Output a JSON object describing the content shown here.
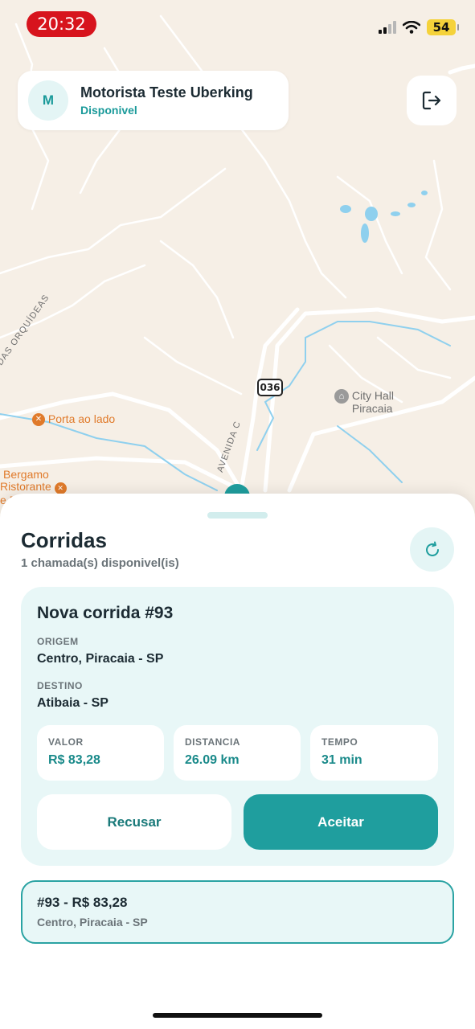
{
  "status_bar": {
    "time": "20:32",
    "battery": "54"
  },
  "map": {
    "labels": {
      "orquideas": "DAS ORQUÍDEAS",
      "porta": "Porta ao lado",
      "city_hall_line1": "City Hall",
      "city_hall_line2": "Piracaia",
      "avenida": "AVENIDA C",
      "bergamo_line1": "Bergamo",
      "bergamo_line2": "Ristorante",
      "bergamo_line3": "e F",
      "route": "036"
    }
  },
  "driver": {
    "initial": "M",
    "name": "Motorista Teste Uberking",
    "status": "Disponivel"
  },
  "sheet": {
    "title": "Corridas",
    "subtitle": "1 chamada(s) disponivel(is)",
    "ride": {
      "title": "Nova corrida #93",
      "origin_label": "ORIGEM",
      "origin": "Centro, Piracaia - SP",
      "destination_label": "DESTINO",
      "destination": "Atibaia - SP",
      "metrics": [
        {
          "label": "VALOR",
          "value": "R$ 83,28"
        },
        {
          "label": "DISTANCIA",
          "value": "26.09 km"
        },
        {
          "label": "TEMPO",
          "value": "31 min"
        }
      ],
      "decline_label": "Recusar",
      "accept_label": "Aceitar"
    },
    "list": [
      {
        "title": "#93 - R$ 83,28",
        "subtitle": "Centro, Piracaia - SP"
      }
    ]
  },
  "colors": {
    "accent": "#1f9e9e",
    "accent_light": "#e8f7f7",
    "text_dark": "#1c2b33",
    "map_bg": "#f6efe6",
    "time_pill": "#d7141d"
  }
}
